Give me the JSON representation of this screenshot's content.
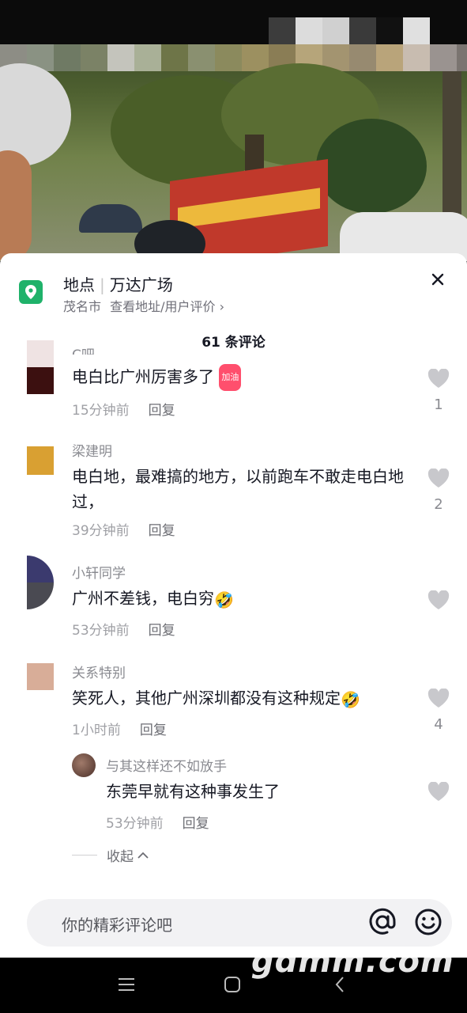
{
  "location": {
    "label": "地点",
    "name": "万达广场",
    "city": "茂名市",
    "link": "查看地址/用户评价",
    "chevron": "›"
  },
  "comment_count": "61 条评论",
  "comments": [
    {
      "name": "C吧",
      "text": "电白比广州厉害多了",
      "badge": "加油",
      "time": "15分钟前",
      "reply": "回复",
      "likes": "1"
    },
    {
      "name": "梁建明",
      "text": "电白地，最难搞的地方，以前跑车不敢走电白地过，",
      "time": "39分钟前",
      "reply": "回复",
      "likes": "2"
    },
    {
      "name": "小轩同学",
      "text": "广州不差钱，电白穷",
      "emoji": "🤣",
      "time": "53分钟前",
      "reply": "回复",
      "likes": ""
    },
    {
      "name": "关系特别",
      "text": "笑死人，其他广州深圳都没有这种规定",
      "emoji": "🤣",
      "time": "1小时前",
      "reply": "回复",
      "likes": "4"
    }
  ],
  "sub_reply": {
    "name": "与其这样还不如放手",
    "text": "东莞早就有这种事发生了",
    "time": "53分钟前",
    "reply": "回复"
  },
  "collapse_label": "收起",
  "input": {
    "placeholder": "你的精彩评论吧"
  },
  "watermark": "gdmm.com",
  "colors": {
    "accent_green": "#1fb26a",
    "like_gray": "#c8c8cc",
    "sheet_bg": "#ffffff"
  },
  "icons": [
    "location-pin-icon",
    "close-icon",
    "heart-icon",
    "at-icon",
    "emoji-icon",
    "menu-icon",
    "home-icon",
    "back-icon"
  ]
}
